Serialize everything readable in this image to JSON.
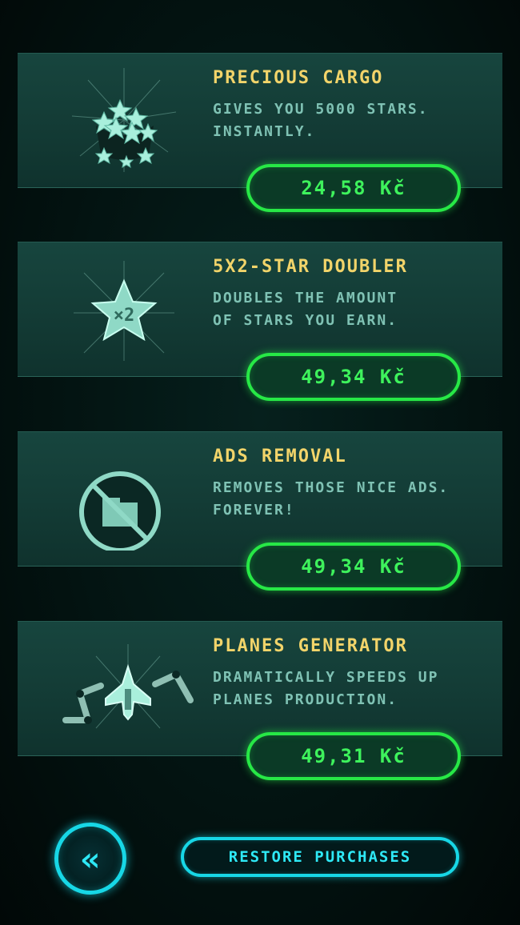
{
  "items": [
    {
      "title": "PRECIOUS CARGO",
      "desc_line1": "GIVES YOU 5000 STARS.",
      "desc_line2": "INSTANTLY.",
      "price": "24,58 Kč",
      "icon": "star-cargo-icon"
    },
    {
      "title": "5X2-STAR DOUBLER",
      "desc_line1": "DOUBLES THE AMOUNT",
      "desc_line2": "OF STARS YOU EARN.",
      "price": "49,34 Kč",
      "icon": "star-doubler-icon"
    },
    {
      "title": "ADS REMOVAL",
      "desc_line1": "REMOVES THOSE NICE ADS.",
      "desc_line2": "FOREVER!",
      "price": "49,34 Kč",
      "icon": "no-ads-icon"
    },
    {
      "title": "PLANES GENERATOR",
      "desc_line1": "DRAMATICALLY SPEEDS UP",
      "desc_line2": "PLANES PRODUCTION.",
      "price": "49,31 Kč",
      "icon": "plane-generator-icon"
    }
  ],
  "footer": {
    "back_glyph": "«",
    "restore_label": "RESTORE PURCHASES"
  },
  "colors": {
    "title": "#f2d46a",
    "desc": "#7fc2b4",
    "price_green": "#27e846",
    "cyan": "#17d7e6"
  }
}
